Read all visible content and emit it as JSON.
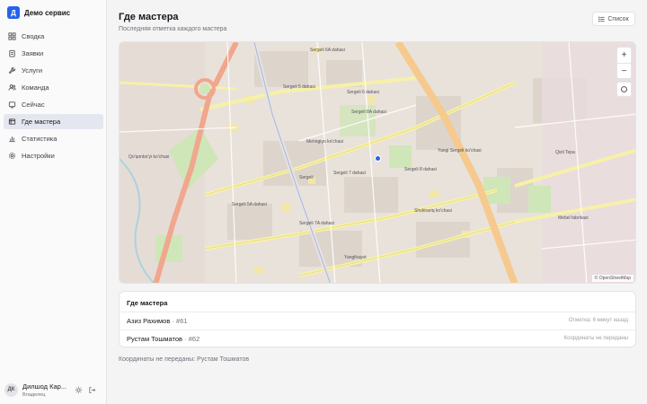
{
  "app": {
    "logo_letter": "Д",
    "name": "Демо сервис"
  },
  "nav": {
    "items": [
      {
        "label": "Сводка",
        "icon": "grid-icon"
      },
      {
        "label": "Заявки",
        "icon": "clipboard-icon"
      },
      {
        "label": "Услуги",
        "icon": "wrench-icon"
      },
      {
        "label": "Команда",
        "icon": "users-icon"
      },
      {
        "label": "Сейчас",
        "icon": "activity-icon"
      },
      {
        "label": "Где мастера",
        "icon": "map-icon",
        "active": true
      },
      {
        "label": "Статистика",
        "icon": "chart-icon"
      },
      {
        "label": "Настройки",
        "icon": "gear-icon"
      }
    ]
  },
  "user": {
    "initials": "ДК",
    "name": "Дилшод Кар...",
    "role": "Владелец"
  },
  "header": {
    "title": "Где мастера",
    "subtitle": "Последняя отметка каждого мастера",
    "list_button": "Список"
  },
  "map": {
    "zoom_in": "+",
    "zoom_out": "−",
    "attribution": "© OpenStreetMap",
    "labels": [
      "Sergeli 6A dahasi",
      "Sergeli 5 dahasi",
      "Sergeli 6 dahasi",
      "Sergeli 8A dahasi",
      "Sergeli 7 dahasi",
      "Sergeli 8 dahasi",
      "Sergeli 5A dahasi",
      "Sergeli 7A dahasi",
      "Sergeli",
      "Yangi Sergeli ko'chasi",
      "Shokirariq ko'chasi",
      "Mehrigiyo ko'chasi",
      "Qo'qonbo'yi ko'chasi",
      "Yangihayot",
      "Mebel fabrikasi",
      "Qizil Tepa"
    ],
    "colors": {
      "base": "#e9e2da",
      "main_road": "#f6c98e",
      "secondary_road": "#f7f1a8",
      "park": "#cfe6b8",
      "water": "#aad3df"
    }
  },
  "masters": {
    "title": "Где мастера",
    "rows": [
      {
        "name": "Азиз Рахимов",
        "id": "· #61",
        "status": "Отметка: 6 минут назад"
      },
      {
        "name": "Рустам Тошматов",
        "id": "· #62",
        "status": "Координаты не переданы"
      }
    ]
  },
  "footer_note": "Координаты не переданы: Рустам Тошматов"
}
